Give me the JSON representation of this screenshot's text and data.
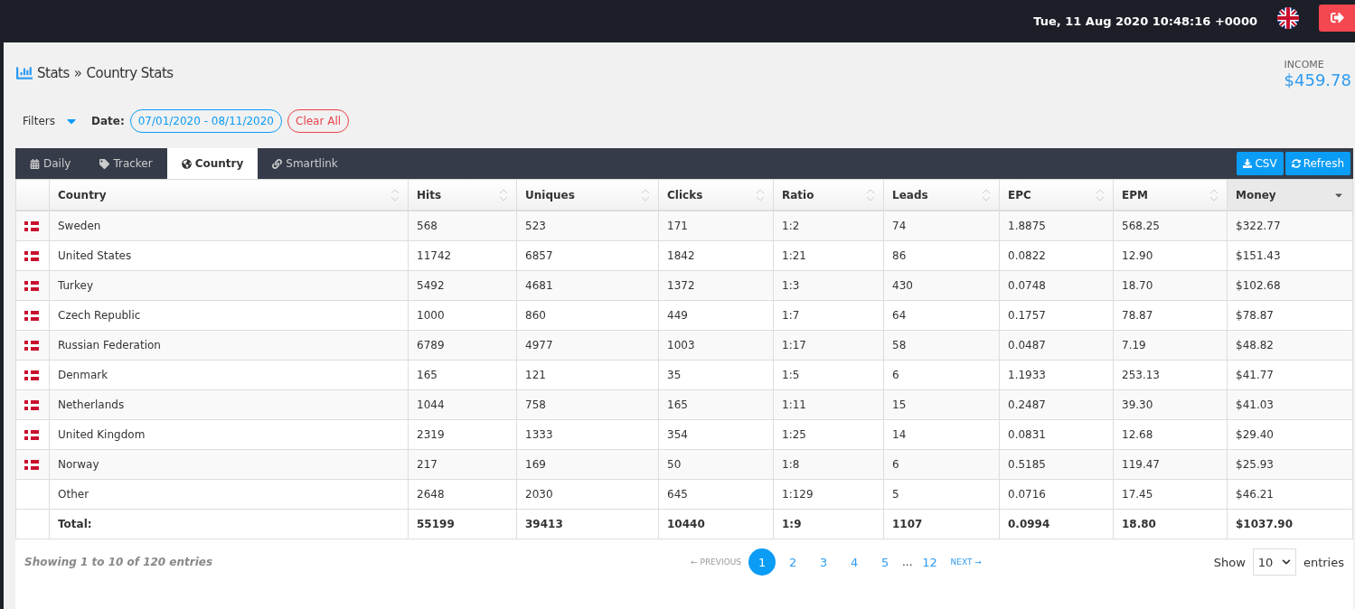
{
  "topbar": {
    "datetime": "Tue, 11 Aug 2020 10:48:16 +0000"
  },
  "breadcrumb": {
    "section": "Stats",
    "separator": "»",
    "page": "Country Stats"
  },
  "income": {
    "label": "INCOME",
    "value": "$459.78"
  },
  "filters": {
    "toggle": "Filters",
    "date_label": "Date:",
    "date_range": "07/01/2020 - 08/11/2020",
    "clear": "Clear All"
  },
  "tabs": [
    {
      "label": "Daily",
      "selected": false
    },
    {
      "label": "Tracker",
      "selected": false
    },
    {
      "label": "Country",
      "selected": true
    },
    {
      "label": "Smartlink",
      "selected": false
    }
  ],
  "actions": [
    {
      "label": "CSV"
    },
    {
      "label": "Refresh"
    }
  ],
  "table": {
    "columns": [
      {
        "label": "Country",
        "sorted": false
      },
      {
        "label": "Hits",
        "sorted": false
      },
      {
        "label": "Uniques",
        "sorted": false
      },
      {
        "label": "Clicks",
        "sorted": false
      },
      {
        "label": "Ratio",
        "sorted": false
      },
      {
        "label": "Leads",
        "sorted": false
      },
      {
        "label": "EPC",
        "sorted": false
      },
      {
        "label": "EPM",
        "sorted": false
      },
      {
        "label": "Money",
        "sorted": true
      }
    ],
    "rows": [
      {
        "flag": true,
        "cells": [
          "Sweden",
          "568",
          "523",
          "171",
          "1:2",
          "74",
          "1.8875",
          "568.25",
          "$322.77"
        ]
      },
      {
        "flag": true,
        "cells": [
          "United States",
          "11742",
          "6857",
          "1842",
          "1:21",
          "86",
          "0.0822",
          "12.90",
          "$151.43"
        ]
      },
      {
        "flag": true,
        "cells": [
          "Turkey",
          "5492",
          "4681",
          "1372",
          "1:3",
          "430",
          "0.0748",
          "18.70",
          "$102.68"
        ]
      },
      {
        "flag": true,
        "cells": [
          "Czech Republic",
          "1000",
          "860",
          "449",
          "1:7",
          "64",
          "0.1757",
          "78.87",
          "$78.87"
        ]
      },
      {
        "flag": true,
        "cells": [
          "Russian Federation",
          "6789",
          "4977",
          "1003",
          "1:17",
          "58",
          "0.0487",
          "7.19",
          "$48.82"
        ]
      },
      {
        "flag": true,
        "cells": [
          "Denmark",
          "165",
          "121",
          "35",
          "1:5",
          "6",
          "1.1933",
          "253.13",
          "$41.77"
        ]
      },
      {
        "flag": true,
        "cells": [
          "Netherlands",
          "1044",
          "758",
          "165",
          "1:11",
          "15",
          "0.2487",
          "39.30",
          "$41.03"
        ]
      },
      {
        "flag": true,
        "cells": [
          "United Kingdom",
          "2319",
          "1333",
          "354",
          "1:25",
          "14",
          "0.0831",
          "12.68",
          "$29.40"
        ]
      },
      {
        "flag": true,
        "cells": [
          "Norway",
          "217",
          "169",
          "50",
          "1:8",
          "6",
          "0.5185",
          "119.47",
          "$25.93"
        ]
      },
      {
        "flag": false,
        "cells": [
          "Other",
          "2648",
          "2030",
          "645",
          "1:129",
          "5",
          "0.0716",
          "17.45",
          "$46.21"
        ]
      }
    ],
    "total": [
      "Total:",
      "55199",
      "39413",
      "10440",
      "1:9",
      "1107",
      "0.0994",
      "18.80",
      "$1037.90"
    ]
  },
  "footer": {
    "info": "Showing 1 to 10 of 120 entries",
    "previous": {
      "label": "← PREVIOUS",
      "disabled": true
    },
    "pages": [
      {
        "label": "1",
        "kind": "page",
        "selected": true
      },
      {
        "label": "2",
        "kind": "page",
        "selected": false
      },
      {
        "label": "3",
        "kind": "page",
        "selected": false
      },
      {
        "label": "4",
        "kind": "page",
        "selected": false
      },
      {
        "label": "5",
        "kind": "page",
        "selected": false
      },
      {
        "label": "...",
        "kind": "gap"
      },
      {
        "label": "12",
        "kind": "page",
        "selected": false
      }
    ],
    "next": {
      "label": "NEXT →",
      "disabled": false
    },
    "show_label": "Show",
    "page_size": "10",
    "entries_label": "entries"
  }
}
